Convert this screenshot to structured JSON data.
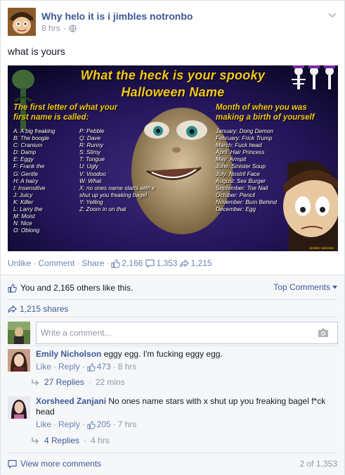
{
  "post": {
    "page_name": "Why helo it is i jimbles notronbo",
    "time": "8 hrs",
    "dot": "·",
    "text": "what is yours"
  },
  "image": {
    "title_line1": "What the heck is your spooky",
    "title_line2": "Halloween Name",
    "left_heading_line1": "The first letter of what your",
    "left_heading_line2": "first name is called:",
    "right_heading_line1": "Month of when you was",
    "right_heading_line2": "making a birth of yourself",
    "letters_col1": [
      "A: A big freaking",
      "B: The boogie",
      "C: Cranium",
      "D: Damp",
      "E: Eggy",
      "F: Frank the",
      "G: Gentle",
      "H: A hairy",
      "I: Insensitive",
      "J: Juicy",
      "K: Killer",
      "L: Larry the",
      "M: Moist",
      "N: Nice",
      "O: Oblong"
    ],
    "letters_col2": [
      "P: Pebble",
      "Q: Dave",
      "R: Runny",
      "S: Slimy",
      "T: Tongue",
      "U: Ugly",
      "V: Voodoo",
      "W: What",
      "X: no ones name starts with x",
      "shut up you freaking bagel",
      "Y: Yelling",
      "Z: Zoom in on that"
    ],
    "months": [
      "January: Dong Demon",
      "February: Frick Trump",
      "March: Fuck head",
      "April: Hair Princess",
      "May: Armpit",
      "June: Sinister Soup",
      "July: Nostril Face",
      "August: Sex Burger",
      "September: Toe Nail",
      "October: Pencil",
      "November: Bum Behind",
      "December: Egg"
    ],
    "credit": "Jimbles Notronbo"
  },
  "actions": {
    "unlike": "Unlike",
    "comment": "Comment",
    "share": "Share",
    "dot": "·",
    "likes_count": "2,166",
    "comments_count": "1,353",
    "shares_count": "1,215"
  },
  "feedback": {
    "likes_text": "You and 2,165 others like this.",
    "top_comments": "Top Comments",
    "shares_text": "1,215 shares",
    "compose_placeholder": "Write a comment..."
  },
  "comments": [
    {
      "author": "Emily Nicholson",
      "text": "eggy egg. I'm fucking eggy egg.",
      "like": "Like",
      "reply": "Reply",
      "likes": "473",
      "time": "8 hrs",
      "replies": "27 Replies",
      "replies_time": "22 mins"
    },
    {
      "author": "Xorsheed Zanjani",
      "text": "No ones name stars with x shut up you freaking bagel f*ck head",
      "like": "Like",
      "reply": "Reply",
      "likes": "205",
      "time": "7 hrs",
      "replies": "4 Replies",
      "replies_time": "4 hrs"
    }
  ],
  "footer": {
    "view_more": "View more comments",
    "count": "2 of 1,353"
  },
  "colors": {
    "link": "#3b5998",
    "link_light": "#6d84b4",
    "meta": "#9197a3",
    "image_title": "#f6c91a",
    "image_bg": "#1a0f3d"
  }
}
